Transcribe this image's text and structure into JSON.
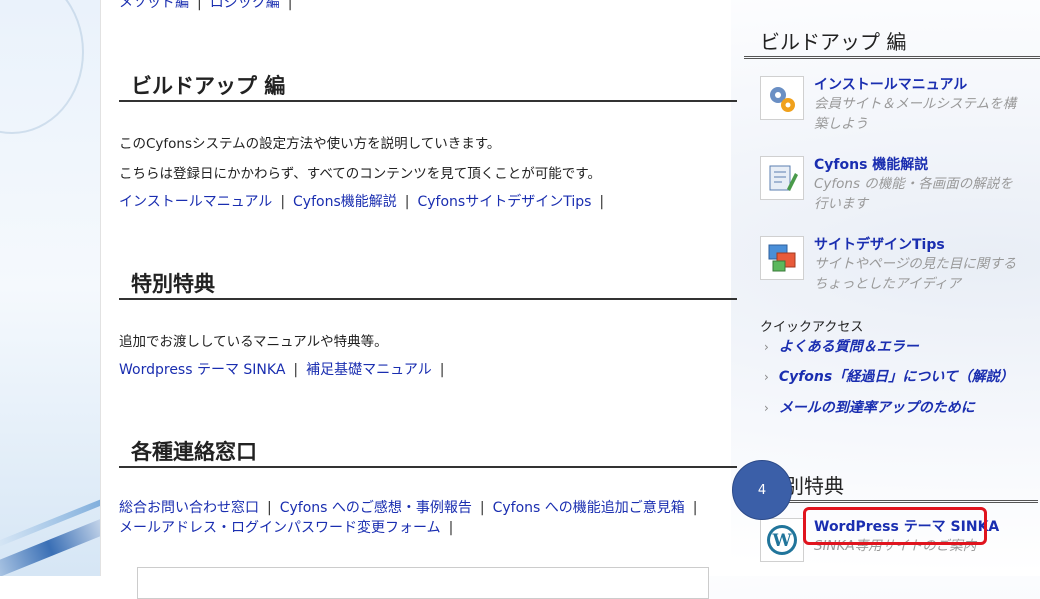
{
  "top_links": [
    "メソッド編",
    "ロジック編"
  ],
  "sections": [
    {
      "title": "ビルドアップ 編",
      "paragraphs": [
        "このCyfonsシステムの設定方法や使い方を説明していきます。",
        "こちらは登録日にかかわらず、すべてのコンテンツを見て頂くことが可能です。"
      ],
      "links": [
        "インストールマニュアル",
        "Cyfons機能解説",
        "CyfonsサイトデザインTips"
      ]
    },
    {
      "title": "特別特典",
      "paragraphs": [
        "追加でお渡ししているマニュアルや特典等。"
      ],
      "links": [
        "Wordpress テーマ SINKA",
        "補足基礎マニュアル"
      ]
    },
    {
      "title": "各種連絡窓口",
      "links_line1": [
        "総合お問い合わせ窓口",
        "Cyfons へのご感想・事例報告",
        "Cyfons への機能追加ご意見箱"
      ],
      "links_line2": [
        "メールアドレス・ログインパスワード変更フォーム"
      ]
    }
  ],
  "sidebar": {
    "buildup_title": "ビルドアップ 編",
    "items": [
      {
        "title": "インストールマニュアル",
        "desc": "会員サイト＆メールシステムを構築しよう",
        "icon": "gears-icon"
      },
      {
        "title": "Cyfons 機能解説",
        "desc": "Cyfons の機能・各画面の解説を行います",
        "icon": "document-pencil-icon"
      },
      {
        "title": "サイトデザインTips",
        "desc": "サイトやページの見た目に関するちょっとしたアイディア",
        "icon": "windows-icon"
      }
    ],
    "quick_access_label": "クイックアクセス",
    "quick_links": [
      "よくある質問＆エラー",
      "Cyfons「経過日」について（解説）",
      "メールの到達率アップのために"
    ],
    "special_title": "別特典",
    "special_item": {
      "title": "WordPress テーマ SINKA",
      "desc": "SINKA専用サイトのご案内",
      "icon": "wordpress-icon"
    }
  },
  "badge": "4",
  "colors": {
    "link": "#1a2eb0",
    "highlight": "#e0141e",
    "badge": "#3b5fa8"
  }
}
